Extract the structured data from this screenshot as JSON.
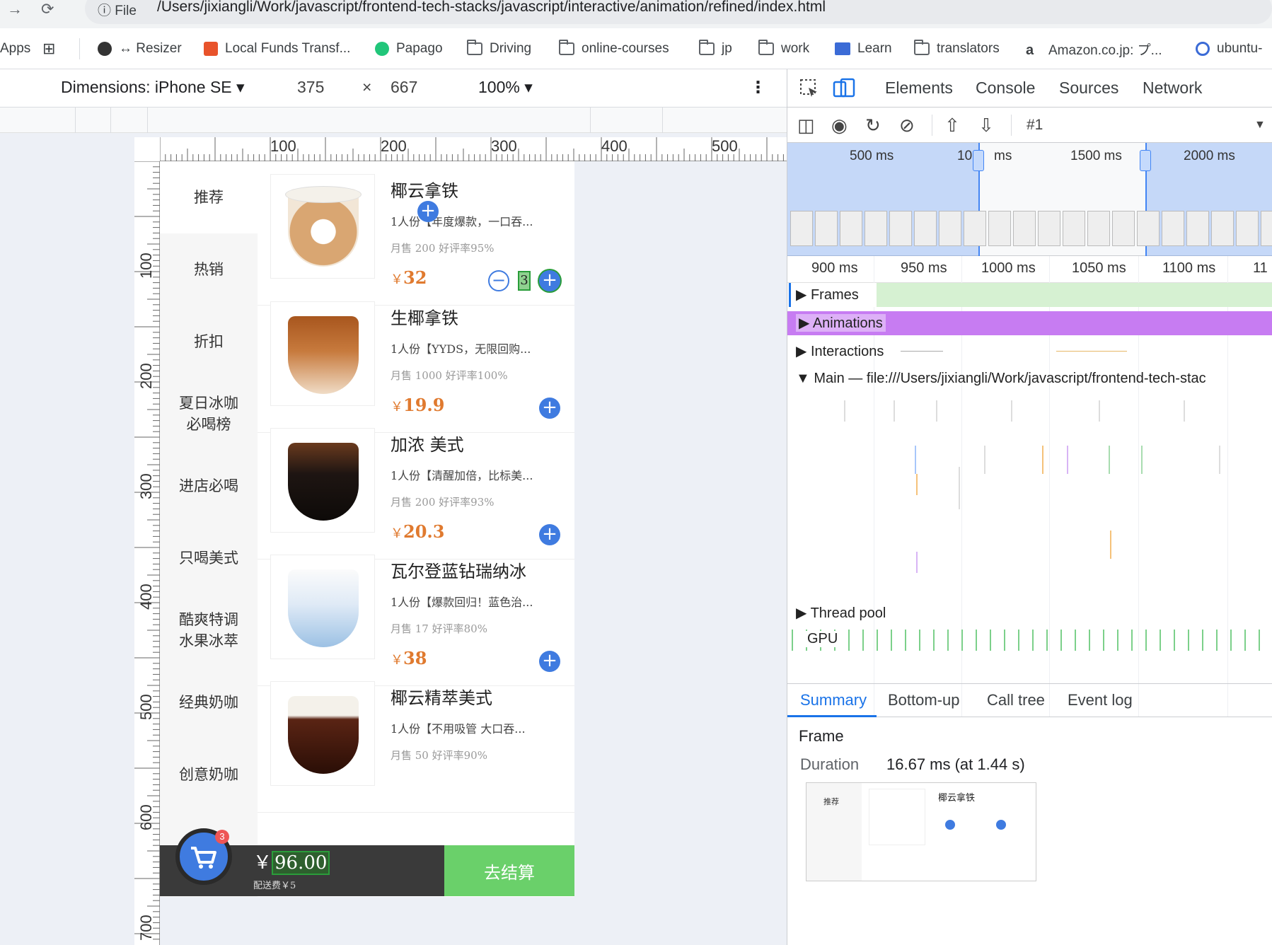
{
  "browser": {
    "nav_back": "→",
    "nav_reload": "⟳",
    "url_scheme": "File",
    "url": "/Users/jixiangli/Work/javascript/frontend-tech-stacks/javascript/interactive/animation/refined/index.html"
  },
  "bookmarks": [
    {
      "label": "Apps",
      "icon": "apps-icon"
    },
    {
      "label": "↔ Resizer",
      "icon": "globe-icon"
    },
    {
      "label": "Local Funds Transf...",
      "icon": "bookmark-icon"
    },
    {
      "label": "Papago",
      "icon": "papago-icon"
    },
    {
      "label": "Driving",
      "icon": "folder-icon"
    },
    {
      "label": "online-courses",
      "icon": "folder-icon"
    },
    {
      "label": "jp",
      "icon": "folder-icon"
    },
    {
      "label": "work",
      "icon": "folder-icon"
    },
    {
      "label": "Learn",
      "icon": "book-icon"
    },
    {
      "label": "translators",
      "icon": "folder-icon"
    },
    {
      "label": "Amazon.co.jp: プ...",
      "icon": "amazon-icon"
    },
    {
      "label": "ubuntu-",
      "icon": "ubuntu-icon"
    }
  ],
  "device_toolbar": {
    "dimensions": "Dimensions: iPhone SE ▾",
    "width": "375",
    "times": "×",
    "height": "667",
    "zoom": "100% ▾",
    "more": "⋮"
  },
  "ruler": {
    "h_labels": [
      "100",
      "200",
      "300",
      "400",
      "500"
    ],
    "v_labels": [
      "100",
      "200",
      "300",
      "400",
      "500",
      "600",
      "700"
    ]
  },
  "app": {
    "categories": [
      {
        "label": "推荐"
      },
      {
        "label": "热销"
      },
      {
        "label": "折扣"
      },
      {
        "label": "夏日冰咖\n必喝榜"
      },
      {
        "label": "进店必喝"
      },
      {
        "label": "只喝美式"
      },
      {
        "label": "酷爽特调\n水果冰萃"
      },
      {
        "label": "经典奶咖"
      },
      {
        "label": "创意奶咖"
      }
    ],
    "products": [
      {
        "name": "椰云拿铁",
        "desc": "1人份【年度爆款，一口吞...",
        "stats": "月售 200   好评率95%",
        "currency": "￥",
        "price": "32",
        "qty": "3",
        "minus": "−",
        "plus": "+"
      },
      {
        "name": "生椰拿铁",
        "desc": "1人份【YYDS，无限回购...",
        "stats": "月售 1000   好评率100%",
        "currency": "￥",
        "price": "19.9",
        "plus": "+"
      },
      {
        "name": "加浓 美式",
        "desc": "1人份【清醒加倍，比标美...",
        "stats": "月售 200   好评率93%",
        "currency": "￥",
        "price": "20.3",
        "plus": "+"
      },
      {
        "name": "瓦尔登蓝钻瑞纳冰",
        "desc": "1人份【爆款回归！蓝色治...",
        "stats": "月售 17   好评率80%",
        "currency": "￥",
        "price": "38",
        "plus": "+"
      },
      {
        "name": "椰云精萃美式",
        "desc": "1人份【不用吸管 大口吞...",
        "stats": "月售 50   好评率90%",
        "currency": "￥",
        "price": "",
        "plus": ""
      }
    ],
    "cart": {
      "badge": "3",
      "currency": "￥",
      "total": "96.00",
      "fee": "配送费￥5",
      "checkout": "去结算"
    }
  },
  "devtools": {
    "tabs": [
      "Elements",
      "Console",
      "Sources",
      "Network"
    ],
    "recording": "#1",
    "overview_labels": [
      "500 ms",
      "10",
      "ms",
      "1500 ms",
      "2000 ms"
    ],
    "timeline_labels": [
      "900 ms",
      "950 ms",
      "1000 ms",
      "1050 ms",
      "1100 ms",
      "11"
    ],
    "tracks": {
      "frames": "Frames",
      "animations": "Animations",
      "interactions": "Interactions",
      "main": "Main — file:///Users/jixiangli/Work/javascript/frontend-tech-stac",
      "thread_pool": "Thread pool",
      "gpu": "GPU"
    },
    "bottom_tabs": [
      "Summary",
      "Bottom-up",
      "Call tree",
      "Event log"
    ],
    "summary": {
      "title": "Frame",
      "duration_label": "Duration",
      "duration_value": "16.67 ms (at 1.44 s)",
      "thumb_cat": "推荐",
      "thumb_name": "椰云拿铁"
    },
    "colors": {
      "accent": "#1a73e8",
      "frames": "#d6f1d2",
      "animations": "#c77cf2",
      "selection": "#4285f4"
    }
  }
}
